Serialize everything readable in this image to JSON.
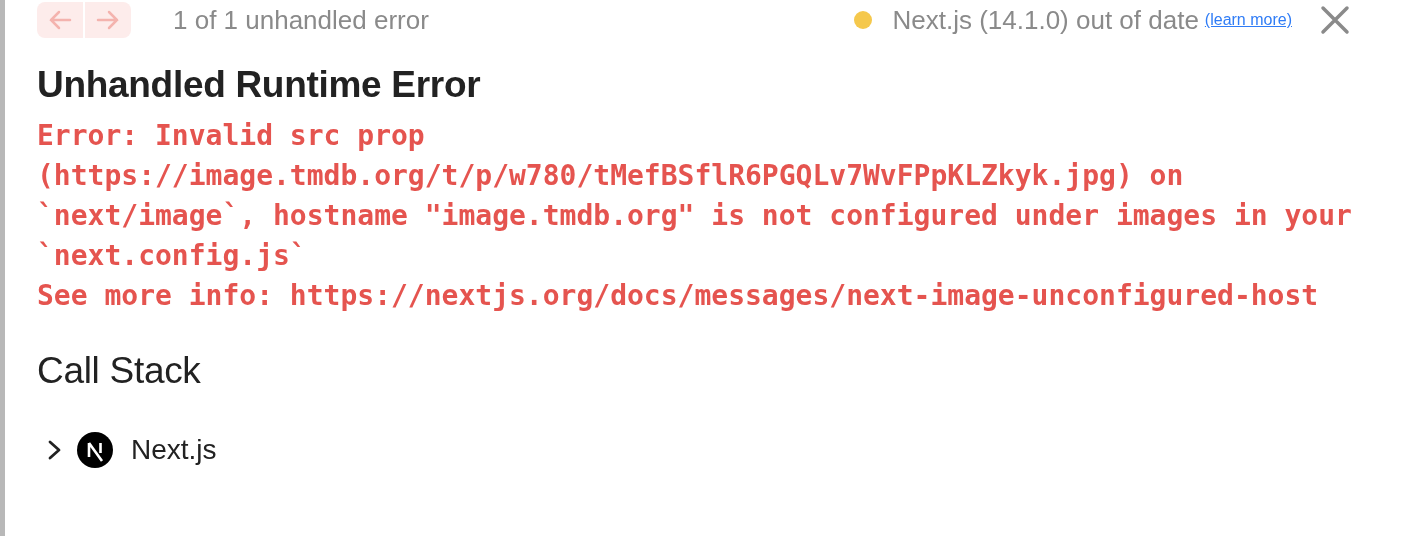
{
  "toolbar": {
    "nav_buttons": [
      {
        "kind": "previous",
        "disabled": true
      },
      {
        "kind": "next",
        "disabled": true
      }
    ],
    "error_count": "1 of 1 unhandled error",
    "version": {
      "text": "Next.js (14.1.0) out of date",
      "link": "(learn more)"
    }
  },
  "title": "Unhandled Runtime Error",
  "error_message": [
    "Error: Invalid src prop (https://image.tmdb.org/t/p/w780/tMefBSflR6PGQLv7WvFPpKLZkyk.jpg) on `next/image`, hostname \"image.tmdb.org\" is not configured under images in your `next.config.js`",
    "See more info: https://nextjs.org/docs/messages/next-image-unconfigured-host"
  ],
  "call_stack": {
    "heading": "Call Stack",
    "frames": [
      {
        "label": "Next.js",
        "expanded": false
      }
    ]
  }
}
